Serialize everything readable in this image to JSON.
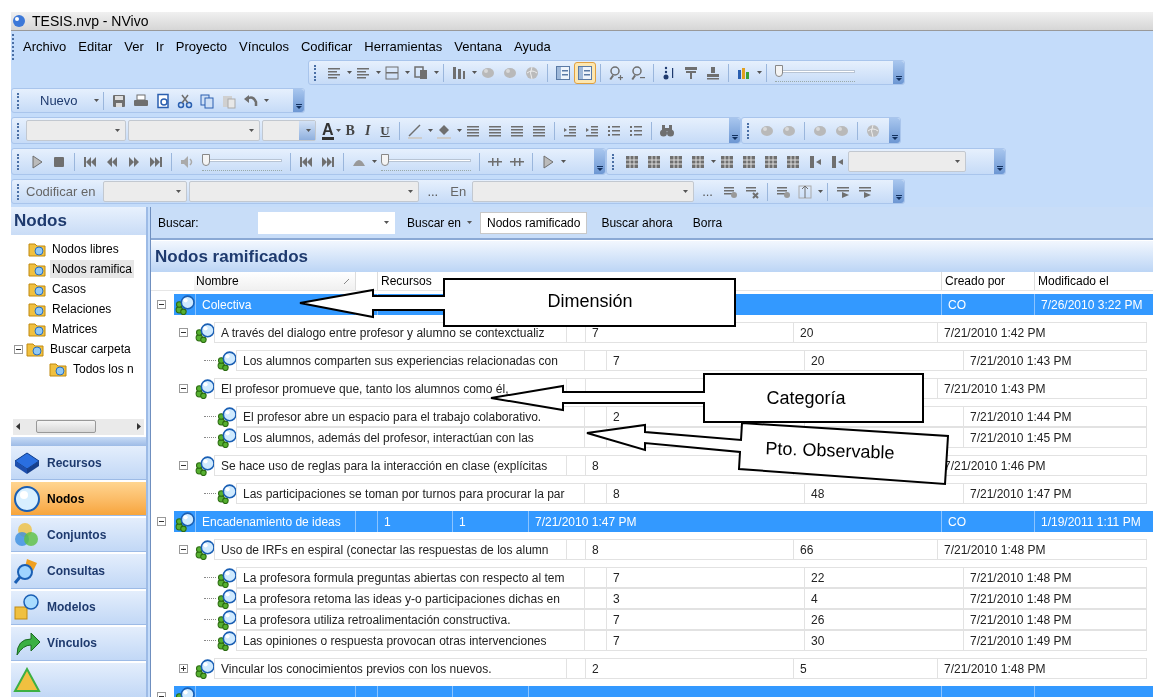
{
  "window": {
    "title": "TESIS.nvp - NVivo"
  },
  "menu": [
    "Archivo",
    "Editar",
    "Ver",
    "Ir",
    "Proyecto",
    "Vínculos",
    "Codificar",
    "Herramientas",
    "Ventana",
    "Ayuda"
  ],
  "toolbars": {
    "new_button": "Nuevo",
    "format_glyphs": [
      "A",
      "B",
      "I",
      "U"
    ],
    "code_label": "Codificar en",
    "ellipsis_1": "...",
    "in_label": "En",
    "ellipsis_2": "...",
    "sliders": [
      {
        "level": 0
      },
      {
        "level": 0
      },
      {
        "level": 0
      }
    ],
    "view_toggles": [
      {
        "selected": false
      },
      {
        "selected": true
      }
    ]
  },
  "sidebar": {
    "title": "Nodos",
    "folders": [
      {
        "label": "Nodos libres",
        "selected": false
      },
      {
        "label": "Nodos ramifica",
        "selected": true
      },
      {
        "label": "Casos",
        "selected": false
      },
      {
        "label": "Relaciones",
        "selected": false
      },
      {
        "label": "Matrices",
        "selected": false
      },
      {
        "label": "Buscar carpeta",
        "selected": false,
        "expanded": true,
        "children": [
          {
            "label": "Todos los n",
            "selected": false
          }
        ]
      }
    ],
    "nav": [
      {
        "label": "Recursos",
        "selected": false
      },
      {
        "label": "Nodos",
        "selected": true
      },
      {
        "label": "Conjuntos",
        "selected": false
      },
      {
        "label": "Consultas",
        "selected": false
      },
      {
        "label": "Modelos",
        "selected": false
      },
      {
        "label": "Vínculos",
        "selected": false
      }
    ]
  },
  "search": {
    "label": "Buscar:",
    "scope_button": "Buscar en",
    "scope_value": "Nodos ramificado",
    "buttons": [
      "Buscar ahora",
      "Borra"
    ]
  },
  "table": {
    "title": "Nodos ramificados",
    "columns": [
      "Nombre",
      "Recursos",
      "Creado por",
      "Modificado el"
    ],
    "rows": [
      {
        "name": "Colectiva",
        "selected": true,
        "expanded": true,
        "creado_por": "CO",
        "modificado_el": "7/26/2010 3:22 PM",
        "children": [
          {
            "name": "A través del dialogo entre profesor y alumno se contexctualiz",
            "selected": false,
            "expanded": true,
            "recursos": "7",
            "column_3": "20",
            "column_4": "7/21/2010 1:42 PM",
            "children": [
              {
                "name": "Los alumnos comparten sus experiencias relacionadas con",
                "selected": false,
                "recursos": "7",
                "column_3": "20",
                "column_4": "7/21/2010 1:43 PM"
              }
            ]
          },
          {
            "name": "El profesor promueve que, tanto los alumnos como él,",
            "selected": false,
            "expanded": true,
            "column_4": "7/21/2010 1:43 PM",
            "children": [
              {
                "name": "El profesor abre un espacio para el trabajo colaborativo.",
                "selected": false,
                "recursos": "2",
                "column_4": "7/21/2010 1:44 PM"
              },
              {
                "name": "Los alumnos, además del profesor, interactúan con las",
                "selected": false,
                "column_4": "7/21/2010 1:45 PM"
              }
            ]
          },
          {
            "name": "Se hace uso de reglas para la interacción en clase (explícitas",
            "selected": false,
            "expanded": true,
            "recursos": "8",
            "column_4": "7/21/2010 1:46 PM",
            "children": [
              {
                "name": "Las participaciones se toman por turnos para procurar la par",
                "selected": false,
                "recursos": "8",
                "column_3": "48",
                "column_4": "7/21/2010 1:47 PM"
              }
            ]
          }
        ]
      },
      {
        "name": "Encadenamiento de ideas",
        "selected": true,
        "expanded": true,
        "recursos": "1",
        "column_3": "1",
        "column_4": "7/21/2010 1:47 PM",
        "creado_por": "CO",
        "modificado_el": "1/19/2011 1:11 PM",
        "children": [
          {
            "name": "Uso de IRFs en espiral (conectar las respuestas de los alumn",
            "selected": false,
            "expanded": true,
            "recursos": "8",
            "column_3": "66",
            "column_4": "7/21/2010 1:48 PM",
            "children": [
              {
                "name": "La profesora formula preguntas abiertas con respecto al tem",
                "selected": false,
                "recursos": "7",
                "column_3": "22",
                "column_4": "7/21/2010 1:48 PM"
              },
              {
                "name": "La profesora retoma las ideas y-o participaciones dichas en",
                "selected": false,
                "recursos": "3",
                "column_3": "4",
                "column_4": "7/21/2010 1:48 PM"
              },
              {
                "name": "La profesora utiliza retroalimentación constructiva.",
                "selected": false,
                "recursos": "7",
                "column_3": "26",
                "column_4": "7/21/2010 1:48 PM"
              },
              {
                "name": "Las opiniones o respuesta provocan otras intervenciones",
                "selected": false,
                "recursos": "7",
                "column_3": "30",
                "column_4": "7/21/2010 1:49 PM"
              }
            ]
          },
          {
            "name": "Vincular los conocimientos previos con los nuevos.",
            "selected": false,
            "expanded": false,
            "recursos": "2",
            "column_3": "5",
            "column_4": "7/21/2010 1:48 PM"
          }
        ]
      },
      {
        "selected": true,
        "expanded": true
      }
    ]
  },
  "callouts": [
    {
      "label": "Dimensión"
    },
    {
      "label": "Categoría"
    },
    {
      "label": "Pto. Observable"
    }
  ]
}
